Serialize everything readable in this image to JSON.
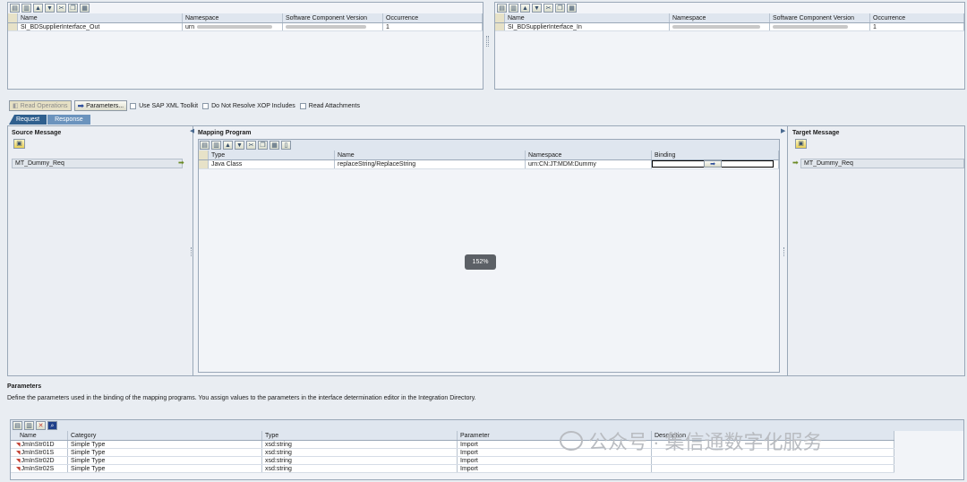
{
  "top_left_grid": {
    "headers": [
      "Name",
      "Namespace",
      "Software Component Version",
      "Occurrence"
    ],
    "row": {
      "name": "SI_BDSupplierInterface_Out",
      "namespace": "urn",
      "occurrence": "1"
    }
  },
  "top_right_grid": {
    "headers": [
      "Name",
      "Namespace",
      "Software Component Version",
      "Occurrence"
    ],
    "row": {
      "name": "SI_BDSupplierInterface_In",
      "occurrence": "1"
    }
  },
  "actions": {
    "read_operations": "Read Operations",
    "parameters": "Parameters...",
    "use_sap_xml": "Use SAP XML Toolkit",
    "no_resolve_xop": "Do Not Resolve XOP Includes",
    "read_attachments": "Read Attachments"
  },
  "tabs": {
    "request": "Request",
    "response": "Response"
  },
  "source": {
    "title": "Source Message",
    "item": "MT_Dummy_Req"
  },
  "mapping": {
    "title": "Mapping Program",
    "headers": [
      "Type",
      "Name",
      "Namespace",
      "Binding"
    ],
    "row": {
      "type": "Java Class",
      "name": "replaceString/ReplaceString",
      "namespace": "urn:CN:JT:MDM:Dummy",
      "binding": ""
    }
  },
  "target": {
    "title": "Target Message",
    "item": "MT_Dummy_Req"
  },
  "zoom": "152%",
  "parameters": {
    "title": "Parameters",
    "description": "Define the parameters used in the binding of the mapping programs. You assign values to the parameters in the interface determination editor in the Integration Directory.",
    "headers": [
      "Name",
      "Category",
      "Type",
      "Parameter",
      "Description"
    ],
    "rows": [
      {
        "name": "JmInStr01D",
        "category": "Simple Type",
        "type": "xsd:string",
        "parameter": "Import"
      },
      {
        "name": "JmInStr01S",
        "category": "Simple Type",
        "type": "xsd:string",
        "parameter": "Import"
      },
      {
        "name": "JmInStr02D",
        "category": "Simple Type",
        "type": "xsd:string",
        "parameter": "Import"
      },
      {
        "name": "JmInStr02S",
        "category": "Simple Type",
        "type": "xsd:string",
        "parameter": "Import"
      }
    ]
  },
  "watermark": "公众号 · 集信通数字化服务",
  "colors": {
    "tab_active": "#2f5f8e",
    "tab_inactive": "#6b93bd",
    "accent_yellow": "#e8cf58",
    "arrow_green": "#6a8a22"
  }
}
